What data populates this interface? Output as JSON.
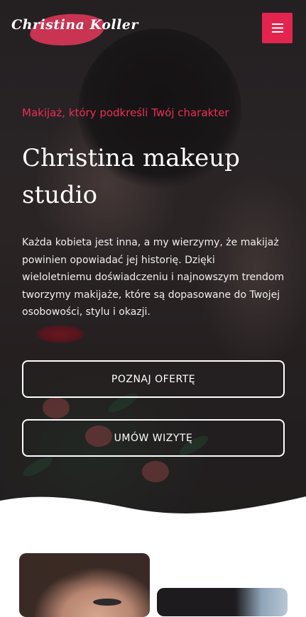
{
  "header": {
    "logo_text": "Christina Koller",
    "menu_icon": "hamburger-icon",
    "accent_color": "#e4244f"
  },
  "hero": {
    "tagline": "Makijaż, który podkreśli Twój charakter",
    "title": "Christina makeup studio",
    "description": "Każda kobieta jest inna, a my wierzymy, że makijaż powinien opowiadać jej historię. Dzięki wieloletniemu doświadczeniu i najnowszym trendom tworzymy makijaże, które są dopasowane do Twojej osobowości, stylu i okazji.",
    "buttons": [
      {
        "label": "POZNAJ OFERTĘ"
      },
      {
        "label": "UMÓW WIZYTĘ"
      }
    ]
  }
}
